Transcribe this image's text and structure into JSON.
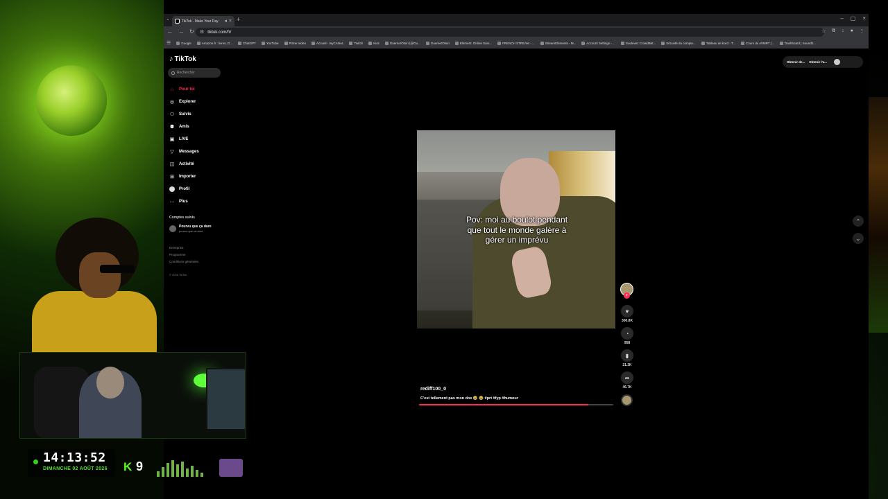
{
  "browser": {
    "tab_title": "TikTok - Make Your Day",
    "new_tab": "+",
    "url": "tiktok.com/fr/",
    "bookmarks": [
      "Google",
      "Amazon.fr : livres, D...",
      "ChatGPT",
      "YouTube",
      "Prime Video",
      "Accueil - myCANAL",
      "Twitch",
      "Kick",
      "GuerrierOtsiri (@Gu...",
      "GuerrierOtsiri",
      "Element: Online Sam...",
      "FRENCH STREAM - ...",
      "StreamElements - M...",
      "Account Settings - ...",
      "Soulevez CrowdBet...",
      "Sécurité du compte...",
      "Tableau de bord - T...",
      "Cours du AVMRT (...",
      "Dashboard | Soundb..."
    ]
  },
  "tiktok": {
    "logo": "TikTok",
    "search_placeholder": "Rechercher",
    "nav": [
      "Pour toi",
      "Explorer",
      "Suivis",
      "Amis",
      "LIVE",
      "Messages",
      "Activité",
      "Importer",
      "Profil",
      "Plus"
    ],
    "following_title": "Comptes suivis",
    "following_name": "Pourvu que ça dure",
    "following_handle": "pourvu.que.ca.dure",
    "footer": [
      "Entreprise",
      "Programme",
      "Conditions générales"
    ],
    "copyright": "© 2026 TikTok",
    "top_actions": [
      "Obtenir de...",
      "Obtenir l'a..."
    ],
    "video": {
      "caption": "Pov: moi au boulot pendant que tout le monde galère à gérer un imprévu",
      "username": "rediff100_0",
      "description": "C'est tellement pas mon dos 😂 😂 #prt #fyp #humour",
      "likes": "300.8K",
      "comments": "958",
      "saves": "21.3K",
      "shares": "46.7K",
      "progress": 0.87
    }
  },
  "overlay": {
    "time": "14:13:52",
    "date": "DIMANCHE 02 AOÛT 2026",
    "kick_icon": "K",
    "kick_count": "9"
  },
  "colors": {
    "accent": "#fe2c55",
    "kick": "#53fc18"
  },
  "icons": [
    "home-icon",
    "explore-icon",
    "following-icon",
    "friends-icon",
    "live-icon",
    "messages-icon",
    "activity-icon",
    "upload-icon",
    "profile-icon",
    "more-icon"
  ]
}
